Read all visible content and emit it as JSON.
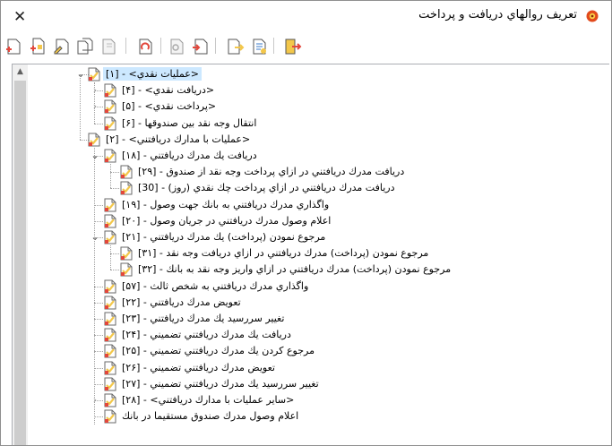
{
  "window": {
    "title": "تعريف روالهاي دريافت و پرداخت",
    "close_glyph": "✕"
  },
  "toolbar": {
    "buttons": [
      {
        "icon": "new-document-icon"
      },
      {
        "icon": "new-subitem-icon"
      },
      {
        "icon": "edit-document-icon"
      },
      {
        "icon": "document-copy-icon"
      },
      {
        "icon": "document-disabled-icon"
      },
      {
        "icon": "document-refresh-icon"
      },
      {
        "icon": "document-find-icon"
      },
      {
        "icon": "document-move-icon"
      },
      {
        "icon": "export-arrow-icon"
      },
      {
        "icon": "report-icon"
      },
      {
        "icon": "exit-icon"
      }
    ]
  },
  "tree": {
    "nodes": [
      {
        "label": "<عمليات نقدي> - [۱]",
        "level": 0,
        "expander": "expanded",
        "selected": true
      },
      {
        "label": "<دريافت نقدي> - [۴]",
        "level": 1,
        "expander": "collapsed"
      },
      {
        "label": "<پرداخت نقدي> - [۵]",
        "level": 1,
        "expander": "collapsed"
      },
      {
        "label": "انتقال وجه نقد بين صندوقها - [۶]",
        "level": 1,
        "expander": ""
      },
      {
        "label": "<عمليات با مدارك دريافتني> - [۲]",
        "level": 0,
        "expander": ""
      },
      {
        "label": "دريافت يك مدرك دريافتني - [۱۸]",
        "level": 1,
        "expander": "expanded"
      },
      {
        "label": "دريافت مدرك دريافتني در ازاي پرداخت وجه نقد از صندوق - [۲۹]",
        "level": 2,
        "expander": ""
      },
      {
        "label": "دريافت مدرك دريافتني در ازاي پرداخت چك نقدي (روز) - [30]",
        "level": 2,
        "expander": ""
      },
      {
        "label": "واگذاري مدرك دريافتني به بانك جهت وصول - [۱۹]",
        "level": 1,
        "expander": ""
      },
      {
        "label": "اعلام وصول مدرك دريافتني در جريان وصول - [۲۰]",
        "level": 1,
        "expander": ""
      },
      {
        "label": "مرجوع نمودن (پرداخت) يك مدرك دريافتني - [۲۱]",
        "level": 1,
        "expander": "expanded"
      },
      {
        "label": "مرجوع نمودن (پرداخت) مدرك دريافتني در ازاي دريافت وجه نقد - [۳۱]",
        "level": 2,
        "expander": ""
      },
      {
        "label": "مرجوع نمودن (پرداخت) مدرك دريافتني در ازاي واريز وجه نقد به بانك - [۳۲]",
        "level": 2,
        "expander": ""
      },
      {
        "label": "واگذاري مدرك دريافتني به شخص ثالث - [۵۷]",
        "level": 1,
        "expander": ""
      },
      {
        "label": "تعويض مدرك دريافتني - [۲۲]",
        "level": 1,
        "expander": ""
      },
      {
        "label": "تغيير سررسيد يك مدرك دريافتني - [۲۳]",
        "level": 1,
        "expander": ""
      },
      {
        "label": "دريافت يك مدرك دريافتني تضميني - [۲۴]",
        "level": 1,
        "expander": ""
      },
      {
        "label": "مرجوع كردن يك مدرك دريافتني تضميني - [۲۵]",
        "level": 1,
        "expander": ""
      },
      {
        "label": "تعويض مدرك دريافتني تضميني - [۲۶]",
        "level": 1,
        "expander": ""
      },
      {
        "label": "تغيير سررسيد يك مدرك دريافتني تضميني - [۲۷]",
        "level": 1,
        "expander": ""
      },
      {
        "label": "<ساير عمليات با مدارك دريافتني> - [۲۸]",
        "level": 1,
        "expander": "collapsed"
      },
      {
        "label": "اعلام وصول مدرك صندوق مستقيما در بانك",
        "level": 1,
        "expander": ""
      }
    ]
  },
  "scrollbar": {
    "up_glyph": "▲"
  },
  "colors": {
    "selection": "#cce8ff",
    "icon_doc": "#f3c74a",
    "icon_accent": "#e2473c"
  }
}
